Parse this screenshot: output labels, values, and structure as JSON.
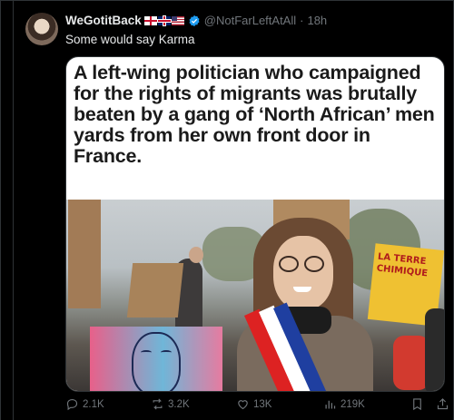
{
  "tweet": {
    "display_name": "WeGotitBack",
    "handle": "@NotFarLeftAtAll",
    "separator": "·",
    "time": "18h",
    "text": "Some would say Karma",
    "image": {
      "headline": "A left-wing politician who campaigned for the rights of migrants was brutally beaten by a gang of ‘North African’ men yards from her own front door in France.",
      "sign_text": "LA TERRE CHIMIQUE"
    },
    "actions": {
      "replies": "2.1K",
      "reposts": "3.2K",
      "likes": "13K",
      "views": "219K"
    }
  },
  "icons": {
    "flags": [
      "england-flag",
      "uk-flag",
      "us-flag"
    ],
    "verified_color": "#1d9bf0"
  }
}
